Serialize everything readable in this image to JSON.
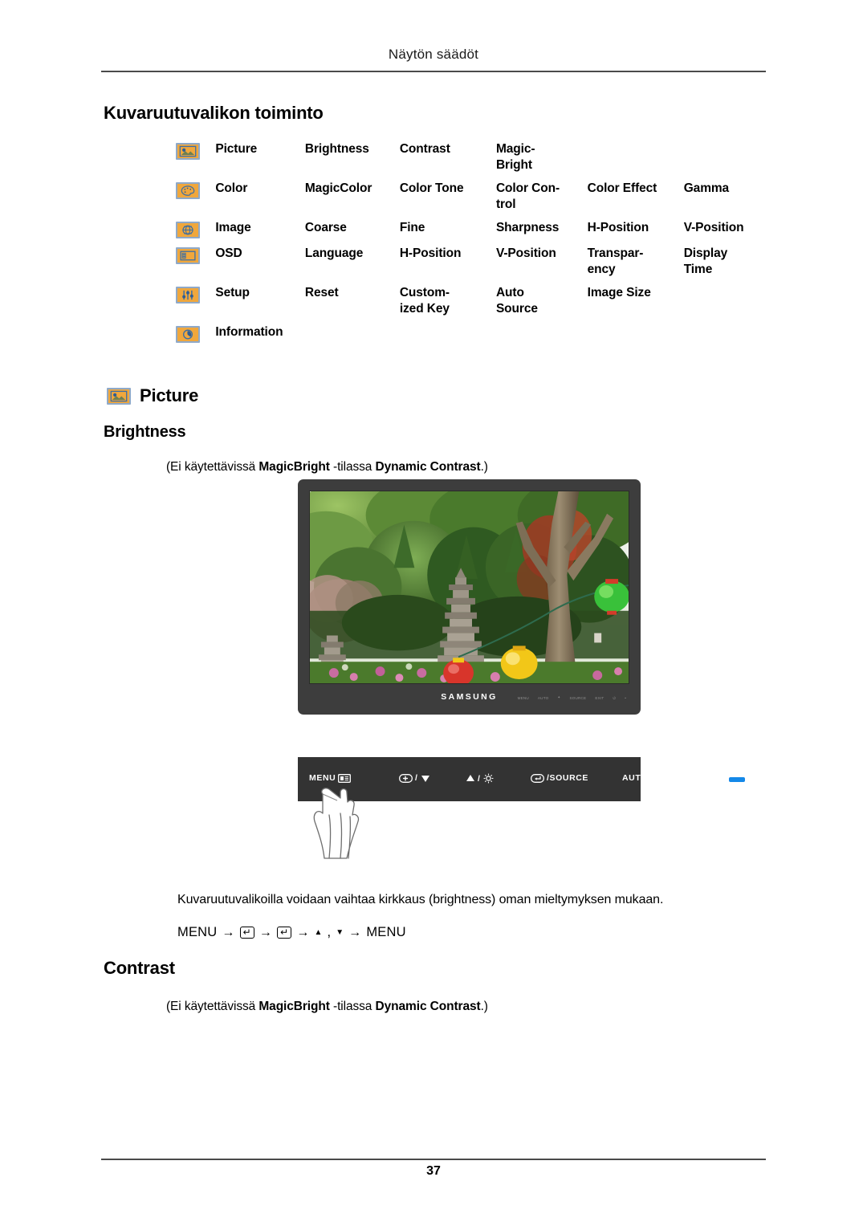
{
  "header": {
    "running_head": "Näytön säädöt"
  },
  "footer": {
    "page_number": "37"
  },
  "sections": {
    "osd_function_title": "Kuvaruutuvalikon toiminto",
    "picture_title": "Picture",
    "brightness_title": "Brightness",
    "contrast_title": "Contrast"
  },
  "menu_table": {
    "rows": [
      {
        "icon": "picture-menu-icon",
        "name": "Picture",
        "items": [
          "Brightness",
          "Contrast",
          "Magic-\nBright",
          "",
          ""
        ]
      },
      {
        "icon": "color-menu-icon",
        "name": "Color",
        "items": [
          "MagicColor",
          "Color Tone",
          "Color  Con-\ntrol",
          "Color Effect",
          "Gamma"
        ]
      },
      {
        "icon": "image-menu-icon",
        "name": "Image",
        "items": [
          "Coarse",
          "Fine",
          "Sharpness",
          "H-Position",
          "V-Position"
        ]
      },
      {
        "icon": "osd-menu-icon",
        "name": "OSD",
        "items": [
          "Language",
          "H-Position",
          "V-Position",
          "Transpar-\nency",
          "Display\nTime"
        ]
      },
      {
        "icon": "setup-menu-icon",
        "name": "Setup",
        "items": [
          "Reset",
          "Custom-\nized Key",
          "Auto\nSource",
          "Image Size",
          ""
        ]
      },
      {
        "icon": "information-menu-icon",
        "name": "Information",
        "items": [
          "",
          "",
          "",
          "",
          ""
        ]
      }
    ]
  },
  "notes": {
    "brightness_note": {
      "prefix": "(Ei käytettävissä ",
      "bold1": "MagicBright",
      "middle": " -tilassa ",
      "bold2": "Dynamic Contrast",
      "suffix": ".)"
    },
    "contrast_note": {
      "prefix": "(Ei käytettävissä ",
      "bold1": "MagicBright",
      "middle": " -tilassa ",
      "bold2": "Dynamic Contrast",
      "suffix": ".)"
    }
  },
  "monitor": {
    "brand": "SAMSUNG",
    "bezel_keys": [
      "MENU",
      "AUTO",
      "✦",
      "SOURCE",
      "EXIT",
      "⏻",
      "•"
    ]
  },
  "control_panel": {
    "keys": [
      {
        "label": "MENU",
        "glyph": "menu-icon"
      },
      {
        "label": "/",
        "glyph": "plus-down-icon"
      },
      {
        "label": "/",
        "glyph": "up-brightness-icon"
      },
      {
        "label": "/SOURCE",
        "glyph": "enter-source-icon"
      },
      {
        "label": "AUTO",
        "glyph": "auto-label"
      },
      {
        "label": "",
        "glyph": "power-icon"
      },
      {
        "label": "",
        "glyph": "led-indicator"
      }
    ]
  },
  "body": {
    "brightness_paragraph": "Kuvaruutuvalikoilla voidaan vaihtaa kirkkaus (brightness) oman mieltymyksen mukaan.",
    "menu_sequence": {
      "start": "MENU",
      "arrow": "→",
      "enter_key": "↵",
      "up_tri": "▲",
      "comma": ",",
      "down_tri": "▼",
      "end": "MENU"
    }
  },
  "colors": {
    "icon_fill": "#f0a73c",
    "icon_border": "#8fa9c8",
    "icon_glyph": "#3b6ea5",
    "panel_bg": "#333333",
    "led_blue": "#1488e8"
  }
}
